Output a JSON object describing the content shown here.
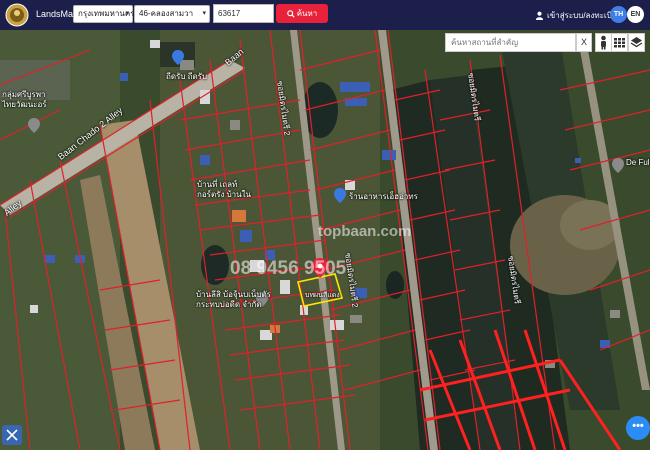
{
  "header": {
    "app_name": "LandsMaps",
    "province_select": "กรุงเทพมหานคร",
    "district_select": "46-คลองสามวา",
    "deed_number": "63617",
    "search_label": "ค้นหา",
    "login_label": "เข้าสู่ระบบ/ลงทะเบียน",
    "lang_th": "TH",
    "lang_en": "EN"
  },
  "map": {
    "place_search_placeholder": "ค้นหาสถานที่สำคัญ",
    "clear_label": "X",
    "labels": {
      "community": "กลุ่มศรีบูรพา\nไทยวัฒนะอร์",
      "house1": "ถีดรับ ถีดรับ",
      "shop1": "บ้านที่ เถลท์\nกอร์ตรัง บ้านใน",
      "shop2": "บ้านลีสิ บ้อจุ้นบเน็บตัร\nกระทบบ่อดีด จำกัด",
      "mart": "ร้านอาหารเอ็ฮอ่าทร",
      "plot": "บทผนสีแดง",
      "df": "De Full"
    },
    "roads": {
      "alley1": "Baan Chado 2 Alley",
      "alley2": "Alley",
      "baan": "Baan",
      "soi1": "ซอยมิตรไมตรี 2",
      "soi2": "ซอยมิตรไมตรี 2",
      "soi3": "ซอยมิตรไมตรี",
      "soi4": "ซอยมิตรไมตรี"
    },
    "watermark_site": "topbaan.com",
    "watermark_phone": "08 9456 9505"
  },
  "fab": {
    "chat_label": "•••"
  }
}
